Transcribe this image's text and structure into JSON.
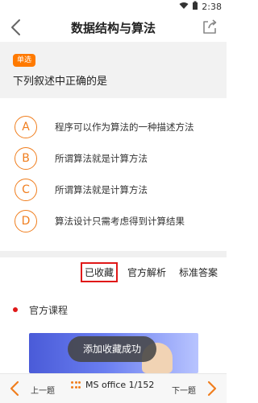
{
  "status": {
    "time": "2:38"
  },
  "header": {
    "title": "数据结构与算法"
  },
  "question": {
    "type_badge": "单选",
    "text": "下列叙述中正确的是",
    "options": [
      {
        "letter": "A",
        "text": "程序可以作为算法的一种描述方法"
      },
      {
        "letter": "B",
        "text": "所谓算法就是计算方法"
      },
      {
        "letter": "C",
        "text": "所谓算法就是计算方法"
      },
      {
        "letter": "D",
        "text": "算法设计只需考虑得到计算结果"
      }
    ]
  },
  "tabs": {
    "favorited": "已收藏",
    "official_analysis": "官方解析",
    "standard_answer": "标准答案"
  },
  "section": {
    "title": "官方课程"
  },
  "toast": {
    "message": "添加收藏成功"
  },
  "bottom": {
    "prev_label": "上一题",
    "next_label": "下一题",
    "progress": "MS office 1/152"
  },
  "colors": {
    "accent": "#f07e1e",
    "badge": "#ff7a00",
    "highlight_border": "#e01818"
  },
  "icons": {
    "back": "chevron-left-icon",
    "share": "share-icon",
    "grid": "grid-dots-icon",
    "wifi": "wifi-icon",
    "battery": "battery-icon"
  }
}
